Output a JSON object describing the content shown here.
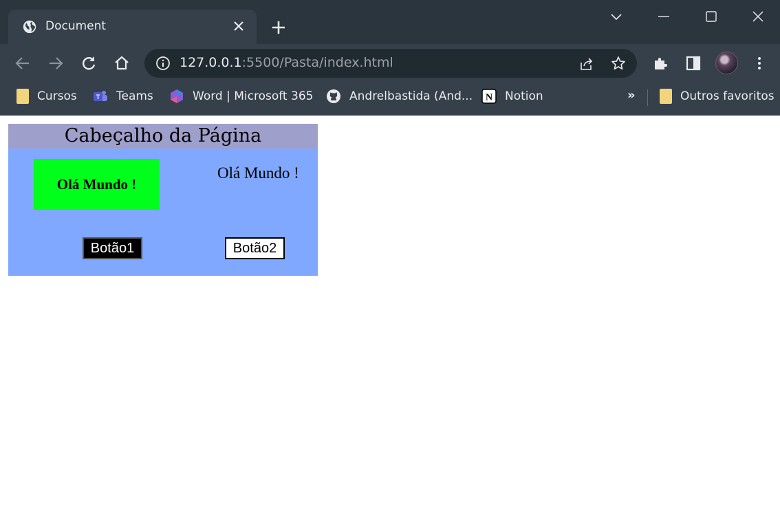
{
  "browser": {
    "tab": {
      "title": "Document",
      "icon": "globe-icon"
    },
    "address": {
      "host": "127.0.0.1",
      "path": ":5500/Pasta/index.html"
    },
    "bookmarks": [
      {
        "label": "Cursos",
        "icon": "folder-icon"
      },
      {
        "label": "Teams",
        "icon": "teams-icon"
      },
      {
        "label": "Word | Microsoft 365",
        "icon": "microsoft365-icon"
      },
      {
        "label": "Andrelbastida (And...",
        "icon": "github-icon"
      },
      {
        "label": "Notion",
        "icon": "notion-icon"
      }
    ],
    "bookmarks_more": "»",
    "other_bookmarks": "Outros favoritos"
  },
  "page": {
    "header": "Cabeçalho da Página",
    "green_box_text": "Olá Mundo !",
    "side_text": "Olá Mundo !",
    "button1": "Botão1",
    "button2": "Botão2"
  },
  "colors": {
    "header_bg": "#9f9fcc",
    "container_bg": "#80a8ff",
    "green_box_bg": "#00ff1a"
  }
}
